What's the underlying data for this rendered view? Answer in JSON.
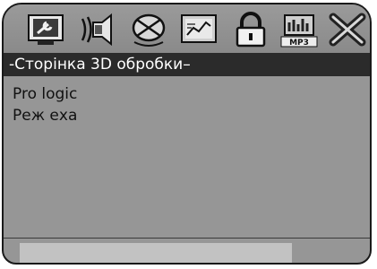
{
  "colors": {
    "panel": "#969696",
    "title_bar": "#2b2b2b",
    "title_text": "#ffffff",
    "text": "#111111",
    "status_bar": "#c2c2c2"
  },
  "toolbar": {
    "icons": [
      {
        "name": "general-setup-icon"
      },
      {
        "name": "audio-setup-icon"
      },
      {
        "name": "video-setup-icon"
      },
      {
        "name": "preference-icon"
      },
      {
        "name": "password-lock-icon"
      },
      {
        "name": "mp3-setup-icon",
        "label": "MP3"
      },
      {
        "name": "exit-icon"
      }
    ]
  },
  "page": {
    "title": "-Сторінка 3D обробки–"
  },
  "menu": {
    "items": [
      "Pro logic",
      "Реж еха"
    ]
  }
}
